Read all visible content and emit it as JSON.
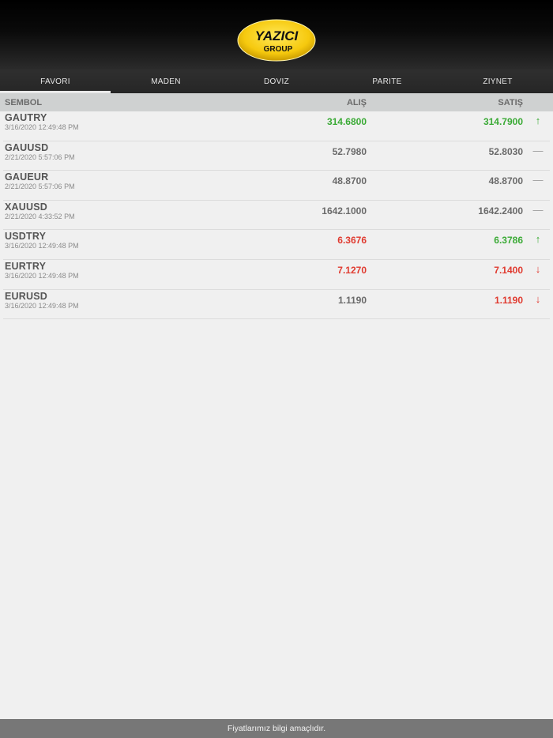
{
  "logo": {
    "line1": "YAZICI",
    "line2": "GROUP"
  },
  "tabs": [
    {
      "label": "FAVORI",
      "active": true
    },
    {
      "label": "MADEN",
      "active": false
    },
    {
      "label": "DOVIZ",
      "active": false
    },
    {
      "label": "PARITE",
      "active": false
    },
    {
      "label": "ZIYNET",
      "active": false
    }
  ],
  "columns": {
    "symbol": "SEMBOL",
    "buy": "ALIŞ",
    "sell": "SATIŞ"
  },
  "rows": [
    {
      "symbol": "GAUTRY",
      "time": "3/16/2020 12:49:48 PM",
      "buy": "314.6800",
      "sell": "314.7900",
      "buy_color": "green",
      "sell_color": "green",
      "trend": "↑",
      "trend_color": "green"
    },
    {
      "symbol": "GAUUSD",
      "time": "2/21/2020 5:57:06 PM",
      "buy": "52.7980",
      "sell": "52.8030",
      "buy_color": "gray",
      "sell_color": "gray",
      "trend": "—",
      "trend_color": "dash"
    },
    {
      "symbol": "GAUEUR",
      "time": "2/21/2020 5:57:06 PM",
      "buy": "48.8700",
      "sell": "48.8700",
      "buy_color": "gray",
      "sell_color": "gray",
      "trend": "—",
      "trend_color": "dash"
    },
    {
      "symbol": "XAUUSD",
      "time": "2/21/2020 4:33:52 PM",
      "buy": "1642.1000",
      "sell": "1642.2400",
      "buy_color": "gray",
      "sell_color": "gray",
      "trend": "—",
      "trend_color": "dash"
    },
    {
      "symbol": "USDTRY",
      "time": "3/16/2020 12:49:48 PM",
      "buy": "6.3676",
      "sell": "6.3786",
      "buy_color": "red",
      "sell_color": "green",
      "trend": "↑",
      "trend_color": "green"
    },
    {
      "symbol": "EURTRY",
      "time": "3/16/2020 12:49:48 PM",
      "buy": "7.1270",
      "sell": "7.1400",
      "buy_color": "red",
      "sell_color": "red",
      "trend": "↓",
      "trend_color": "red"
    },
    {
      "symbol": "EURUSD",
      "time": "3/16/2020 12:49:48 PM",
      "buy": "1.1190",
      "sell": "1.1190",
      "buy_color": "gray",
      "sell_color": "red",
      "trend": "↓",
      "trend_color": "red"
    }
  ],
  "footer": {
    "text": "Fiyatlarımız bilgi amaçlıdır."
  },
  "colors": {
    "up": "#3aaa35",
    "down": "#e03a2f",
    "neutral": "#6a6a6a"
  }
}
